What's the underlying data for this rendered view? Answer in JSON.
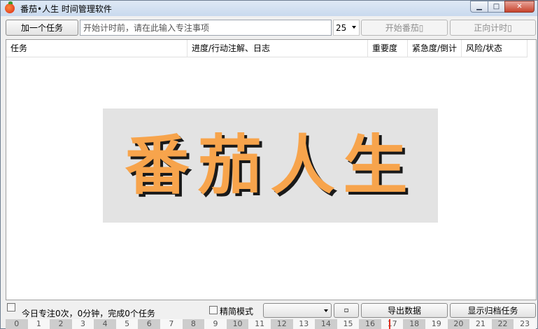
{
  "window": {
    "title": "番茄•人生 时间管理软件",
    "ghost_title": "ILLEGIBLE",
    "controls": {
      "minimize": "▁",
      "maximize": "□",
      "close": "✕"
    }
  },
  "toolbar": {
    "add_task_label": "加一个任务",
    "task_input_placeholder": "开始计时前，请在此输入专注事项",
    "minutes_value": "25",
    "start_pomodoro_label": "开始番茄▯",
    "count_up_label": "正向计时▯"
  },
  "list": {
    "columns": [
      "任务",
      "进度/行动注解、日志",
      "重要度",
      "紧急度/倒计",
      "风险/状态"
    ],
    "logo_text": "番茄人生"
  },
  "statusbar": {
    "summary": "今日专注0次，0分钟，完成0个任务",
    "simple_mode_label": "精简模式",
    "small_button_label": "▫",
    "export_label": "导出数据",
    "archive_label": "显示归档任务"
  },
  "ruler": {
    "hours": [
      "0",
      "1",
      "2",
      "3",
      "4",
      "5",
      "6",
      "7",
      "8",
      "9",
      "10",
      "11",
      "12",
      "13",
      "14",
      "15",
      "16",
      "17",
      "18",
      "19",
      "20",
      "21",
      "22",
      "23"
    ],
    "current_hour": 17
  },
  "colors": {
    "logo_orange": "#f7a44c",
    "marker_red": "#e03020"
  }
}
